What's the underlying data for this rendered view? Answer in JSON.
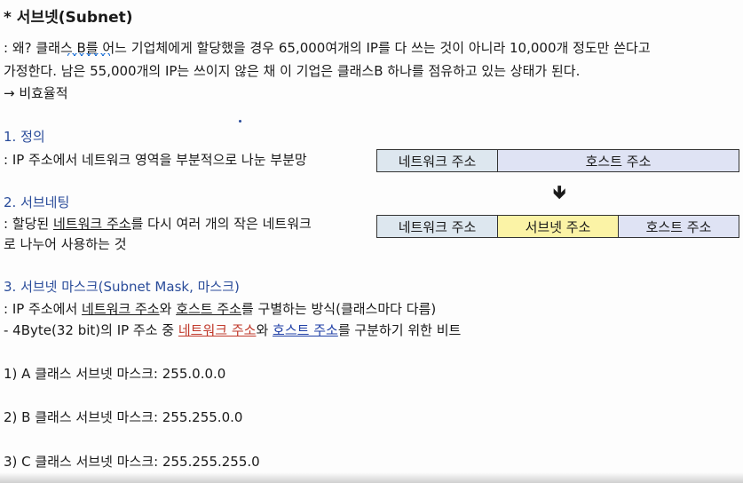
{
  "title": "* 서브넷(Subnet)",
  "intro": {
    "line1": ": 왜? 클래스 B를 어느 기업체에게 할당했을 경우 65,000여개의 IP를 다 쓰는 것이 아니라 10,000개 정도만 쓴다고",
    "line2": "가정한다. 남은 55,000개의 IP는 쓰이지 않은 채 이 기업은 클래스B 하나를 점유하고 있는 상태가 된다.",
    "line3": "→ 비효율적"
  },
  "definition": {
    "heading": "1. 정의",
    "text": ": IP 주소에서 네트워크 영역을 부분적으로 나눈 부분망"
  },
  "subnetting": {
    "heading": "2. 서브네팅",
    "text1_prefix": ": 할당된 ",
    "text1_underline": "네트워크 주소",
    "text1_suffix": "를 다시 여러 개의 작은 네트워크",
    "text2": "로 나누어 사용하는 것"
  },
  "diagram": {
    "row1": {
      "network": "네트워크 주소",
      "host": "호스트 주소"
    },
    "arrow": "🡻",
    "row2": {
      "network": "네트워크 주소",
      "subnet": "서브넷 주소",
      "host": "호스트 주소"
    }
  },
  "mask": {
    "heading": "3. 서브넷 마스크(Subnet Mask, 마스크)",
    "line1_prefix": ": IP 주소에서 ",
    "line1_net": "네트워크 주소",
    "line1_mid": "와 ",
    "line1_host": "호스트 주소",
    "line1_suffix": "를 구별하는 방식(클래스마다 다름)",
    "line2_prefix": "- 4Byte(32 bit)의 IP 주소 중 ",
    "line2_net": "네트워크 주소",
    "line2_mid": "와 ",
    "line2_host": "호스트 주소",
    "line2_suffix": "를 구분하기 위한 비트"
  },
  "classes": [
    "1) A 클래스 서브넷 마스크: 255.0.0.0",
    "2) B 클래스 서브넷 마스크: 255.255.0.0",
    "3) C 클래스 서브넷 마스크: 255.255.255.0"
  ],
  "colors": {
    "heading": "#2a4c9a",
    "network_cell": "#dde7ef",
    "subnet_cell": "#fbf3a6",
    "host_cell": "#dfe3f4",
    "emphasis_red": "#c0392b",
    "emphasis_blue": "#1f3fa6"
  }
}
